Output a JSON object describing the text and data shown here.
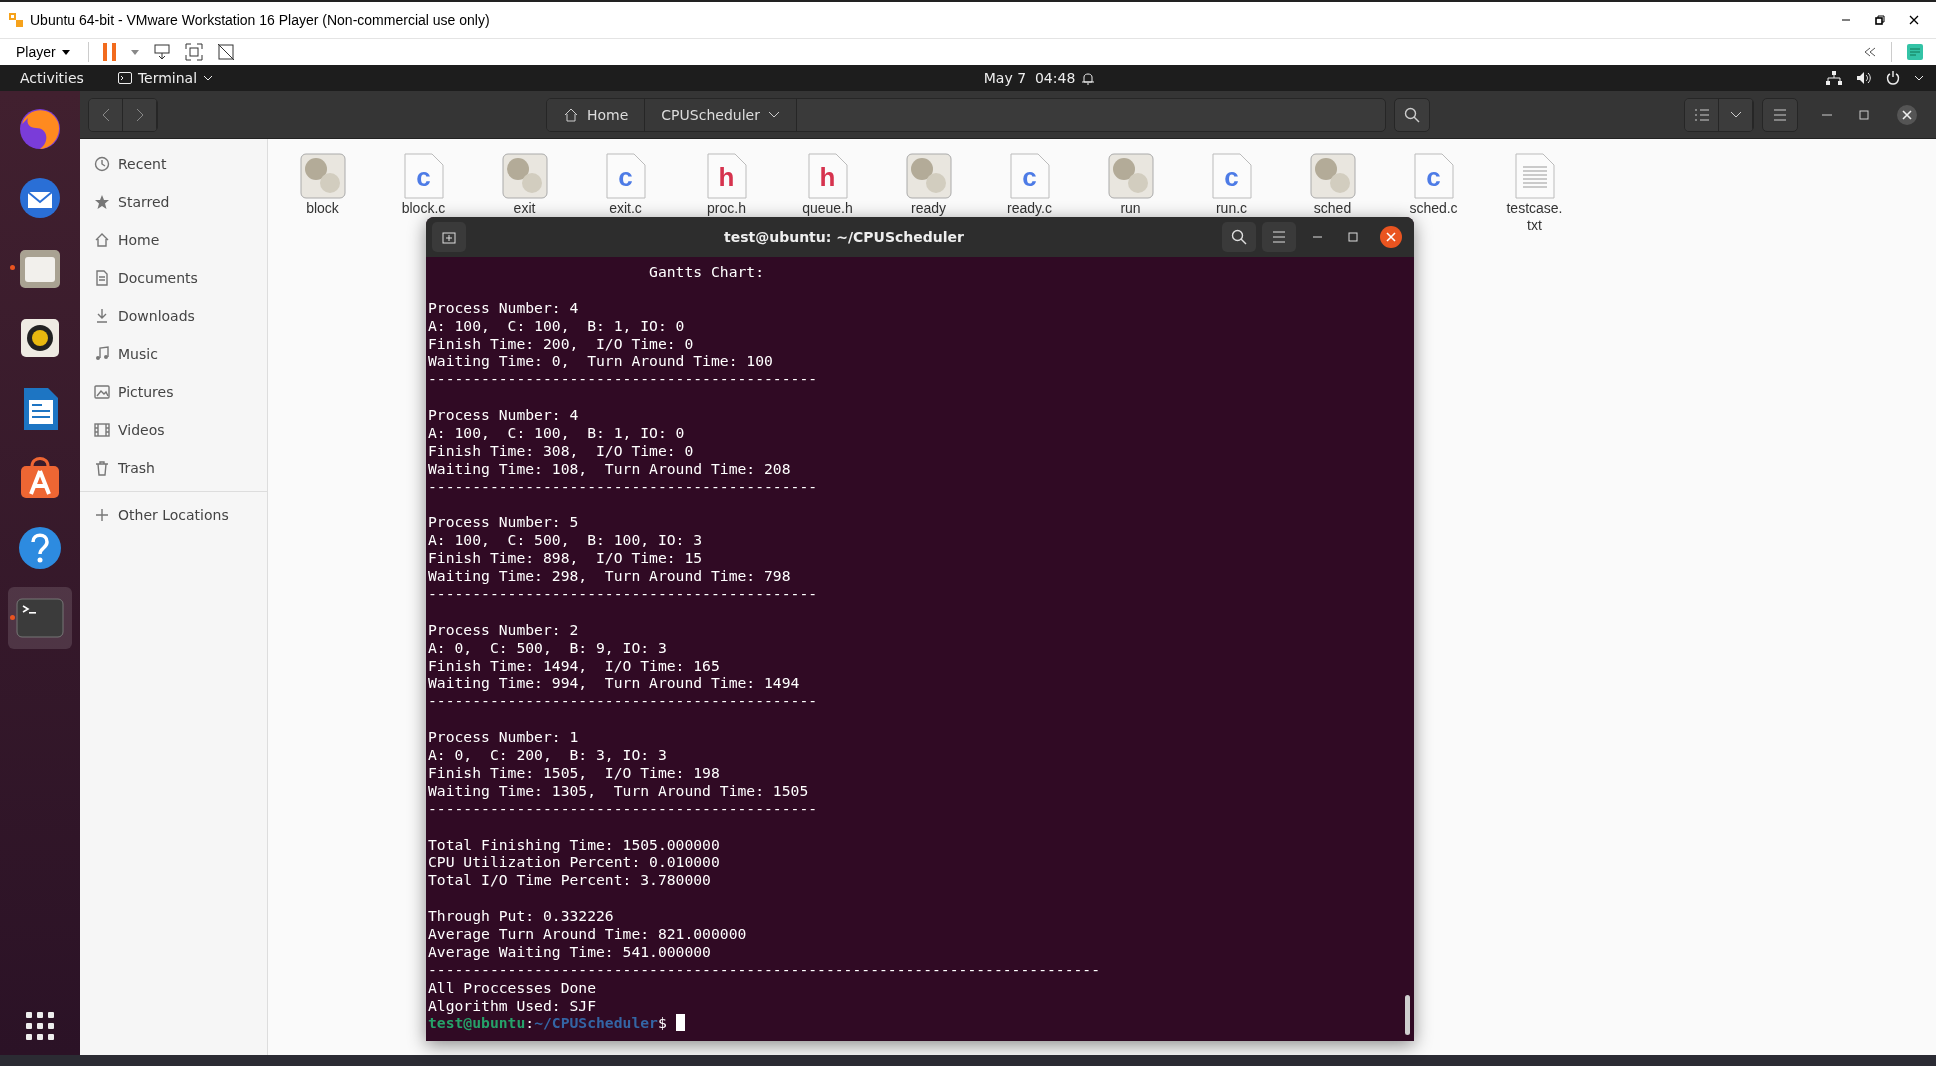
{
  "vm_window": {
    "title": "Ubuntu 64-bit - VMware Workstation 16 Player (Non-commercial use only)",
    "menu": "Player"
  },
  "top_bar": {
    "activities": "Activities",
    "app_menu": "Terminal",
    "clock": "May 7  04:48"
  },
  "dock": {
    "apps": [
      {
        "kind": "firefox",
        "running": false,
        "selected": false
      },
      {
        "kind": "mail",
        "running": false,
        "selected": false
      },
      {
        "kind": "files",
        "running": true,
        "selected": false
      },
      {
        "kind": "music",
        "running": false,
        "selected": false
      },
      {
        "kind": "writer",
        "running": false,
        "selected": false
      },
      {
        "kind": "store",
        "running": false,
        "selected": false
      },
      {
        "kind": "help",
        "running": false,
        "selected": false
      },
      {
        "kind": "terminal",
        "running": true,
        "selected": true
      }
    ]
  },
  "files": {
    "path": [
      {
        "label": "Home",
        "kind": "home"
      },
      {
        "label": "CPUScheduler",
        "kind": "folder"
      }
    ],
    "sidebar": [
      {
        "label": "Recent",
        "kind": "recent"
      },
      {
        "label": "Starred",
        "kind": "starred"
      },
      {
        "label": "Home",
        "kind": "home"
      },
      {
        "label": "Documents",
        "kind": "documents"
      },
      {
        "label": "Downloads",
        "kind": "downloads"
      },
      {
        "label": "Music",
        "kind": "music"
      },
      {
        "label": "Pictures",
        "kind": "pictures"
      },
      {
        "label": "Videos",
        "kind": "videos"
      },
      {
        "label": "Trash",
        "kind": "trash"
      }
    ],
    "other_locations": "Other Locations",
    "items": [
      {
        "name": "block",
        "kind": "exec"
      },
      {
        "name": "block.c",
        "kind": "source",
        "badge": "c"
      },
      {
        "name": "exit",
        "kind": "exec"
      },
      {
        "name": "exit.c",
        "kind": "source",
        "badge": "c"
      },
      {
        "name": "proc.h",
        "kind": "header",
        "badge": "h"
      },
      {
        "name": "queue.h",
        "kind": "header",
        "badge": "h"
      },
      {
        "name": "ready",
        "kind": "exec"
      },
      {
        "name": "ready.c",
        "kind": "source",
        "badge": "c"
      },
      {
        "name": "run",
        "kind": "exec"
      },
      {
        "name": "run.c",
        "kind": "source",
        "badge": "c"
      },
      {
        "name": "sched",
        "kind": "exec"
      },
      {
        "name": "sched.c",
        "kind": "source",
        "badge": "c"
      },
      {
        "name": "testcase.\ntxt",
        "kind": "text"
      }
    ]
  },
  "terminal": {
    "title": "test@ubuntu: ~/CPUScheduler",
    "blocks": [
      [
        "                         Gantts Chart:"
      ],
      [
        "Process Number: 4",
        "A: 100,  C: 100,  B: 1, IO: 0",
        "Finish Time: 200,  I/O Time: 0",
        "Waiting Time: 0,  Turn Around Time: 100",
        "--------------------------------------------"
      ],
      [
        "Process Number: 4",
        "A: 100,  C: 100,  B: 1, IO: 0",
        "Finish Time: 308,  I/O Time: 0",
        "Waiting Time: 108,  Turn Around Time: 208",
        "--------------------------------------------"
      ],
      [
        "Process Number: 5",
        "A: 100,  C: 500,  B: 100, IO: 3",
        "Finish Time: 898,  I/O Time: 15",
        "Waiting Time: 298,  Turn Around Time: 798",
        "--------------------------------------------"
      ],
      [
        "Process Number: 2",
        "A: 0,  C: 500,  B: 9, IO: 3",
        "Finish Time: 1494,  I/O Time: 165",
        "Waiting Time: 994,  Turn Around Time: 1494",
        "--------------------------------------------"
      ],
      [
        "Process Number: 1",
        "A: 0,  C: 200,  B: 3, IO: 3",
        "Finish Time: 1505,  I/O Time: 198",
        "Waiting Time: 1305,  Turn Around Time: 1505",
        "--------------------------------------------"
      ],
      [
        "Total Finishing Time: 1505.000000",
        "CPU Utilization Percent: 0.010000",
        "Total I/O Time Percent: 3.780000"
      ],
      [
        "Through Put: 0.332226",
        "Average Turn Around Time: 821.000000",
        "Average Waiting Time: 541.000000",
        "----------------------------------------------------------------------------",
        "All Proccesses Done",
        "Algorithm Used: SJF"
      ]
    ],
    "prompt": {
      "user": "test@ubuntu",
      "separator": ":",
      "path": "~/CPUScheduler",
      "symbol": "$"
    }
  }
}
